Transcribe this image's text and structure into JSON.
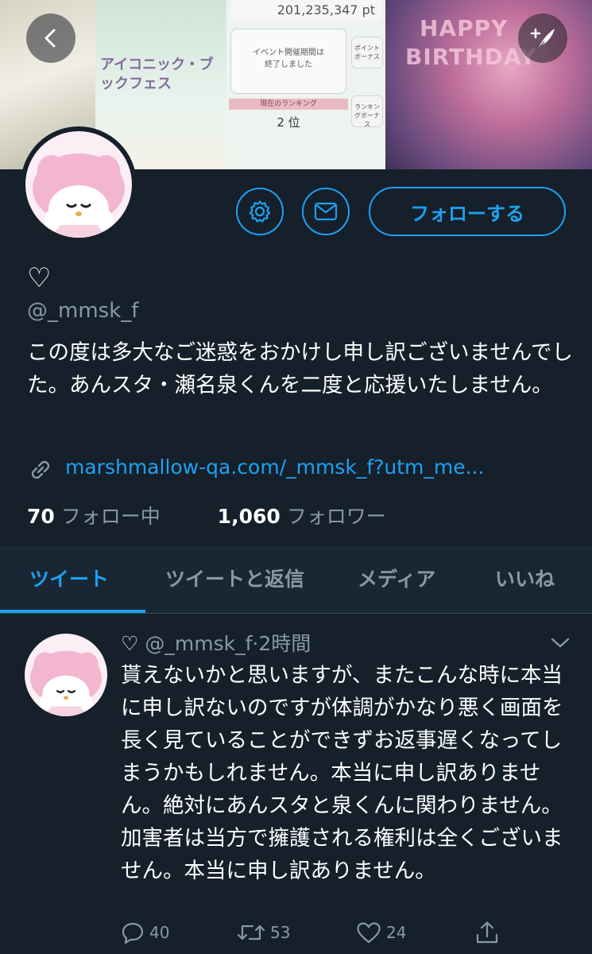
{
  "banner": {
    "score_text": "201,235,347 pt",
    "panel_text_line1": "イベント開催期間は",
    "panel_text_line2": "終了しました",
    "point_bonus": "ポイントボーナス",
    "ranking_label": "現在のランキング",
    "ranking_value": "2 位",
    "ranking_bonus": "ランキングボーナス",
    "game_title": "アイコニック・ブックフェス",
    "birthday_line1": "HAPPY",
    "birthday_line2": "BIRTHDAY"
  },
  "header": {
    "back_icon": "chevron-left-icon",
    "compose_icon": "compose-tweet-icon"
  },
  "profile": {
    "name": "♡",
    "handle": "@_mmsk_f",
    "bio": "この度は多大なご迷惑をおかけし申し訳ございませんでした。あんスタ・瀬名泉くんを二度と応援いたしません。",
    "link": "marshmallow-qa.com/_mmsk_f?utm_me...",
    "following_count": "70",
    "following_label": "フォロー中",
    "followers_count": "1,060",
    "followers_label": "フォロワー",
    "follow_button": "フォローする"
  },
  "tabs": [
    {
      "label": "ツイート",
      "active": true
    },
    {
      "label": "ツイートと返信",
      "active": false
    },
    {
      "label": "メディア",
      "active": false
    },
    {
      "label": "いいね",
      "active": false
    }
  ],
  "tweet": {
    "name": "♡",
    "handle": "@_mmsk_f",
    "separator": "·",
    "time": "2時間",
    "text": "貰えないかと思いますが、またこんな時に本当に申し訳ないのですが体調がかなり悪く画面を長く見ていることができずお返事遅くなってしまうかもしれません。本当に申し訳ありません。絶対にあんスタと泉くんに関わりません。加害者は当方で擁護される権利は全くございません。本当に申し訳ありません。",
    "replies": "40",
    "retweets": "53",
    "likes": "24"
  },
  "colors": {
    "background": "#15202b",
    "tab_bar": "#192734",
    "accent": "#1da1f2",
    "secondary_text": "#8899a6"
  }
}
